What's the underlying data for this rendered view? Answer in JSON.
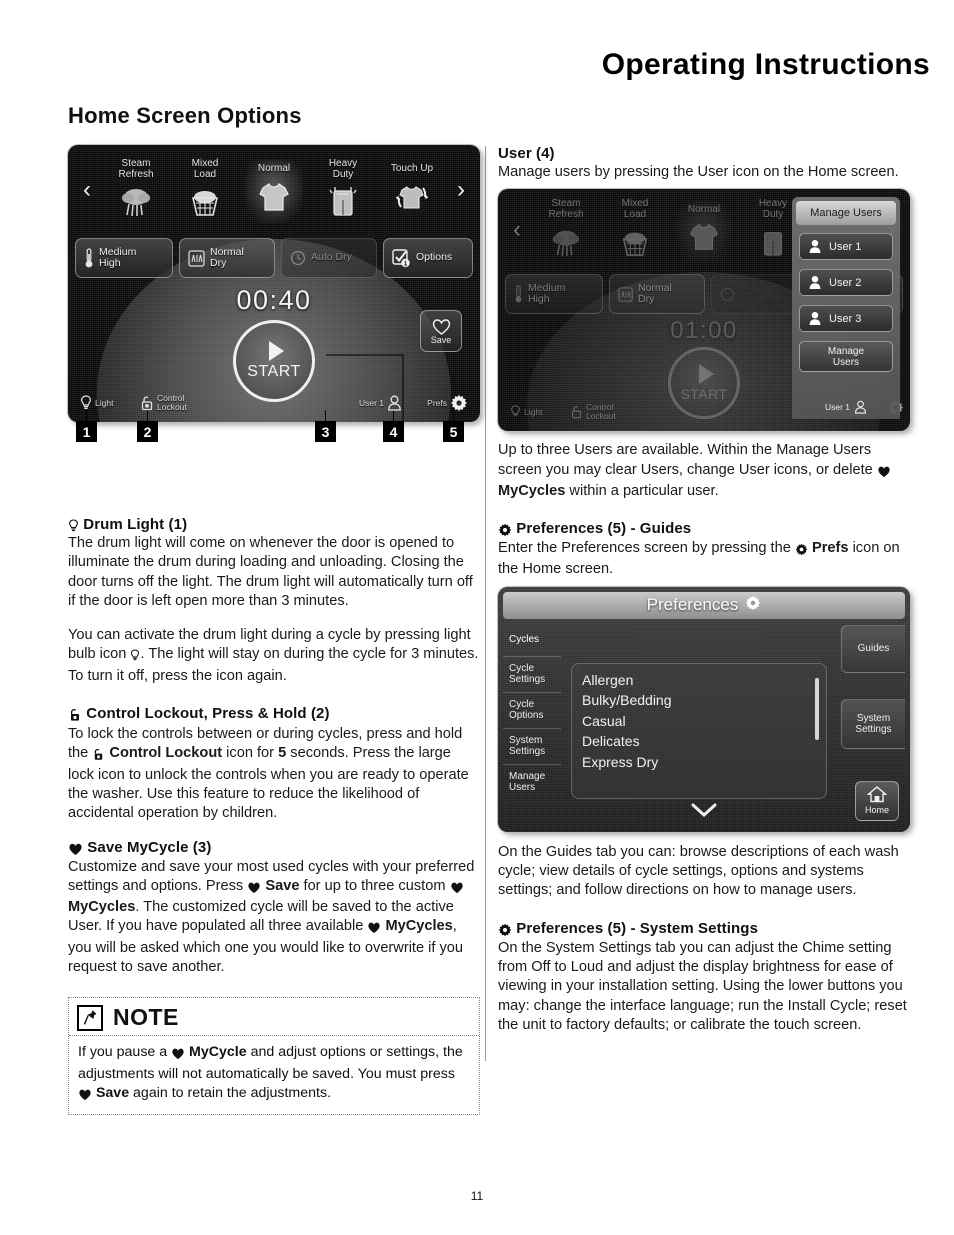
{
  "header": {
    "running_head": "Operating Instructions",
    "section_title": "Home Screen Options",
    "page_number": "11"
  },
  "control_panel": {
    "caption_numbers": [
      "1",
      "2",
      "3",
      "4",
      "5"
    ],
    "prev_arrow": "‹",
    "next_arrow": "›",
    "cycles": [
      {
        "label": "Steam\nRefresh",
        "icon": "steam-refresh-icon",
        "selected": false
      },
      {
        "label": "Mixed\nLoad",
        "icon": "basket-icon",
        "selected": false
      },
      {
        "label": "Normal",
        "icon": "tshirt-icon",
        "selected": true
      },
      {
        "label": "Heavy\nDuty",
        "icon": "overalls-icon",
        "selected": false
      },
      {
        "label": "Touch Up",
        "icon": "touch-up-icon",
        "selected": false
      }
    ],
    "setting_buttons": [
      {
        "label": "Medium\nHigh",
        "icon": "thermometer-icon",
        "enabled": true
      },
      {
        "label": "Normal\nDry",
        "icon": "dryness-icon",
        "enabled": true
      },
      {
        "label": "Auto Dry",
        "icon": "clock-icon",
        "enabled": false
      },
      {
        "label": "Options",
        "icon": "checkbox-icon",
        "badge": "1",
        "enabled": true
      }
    ],
    "timer": "00:40",
    "start_label": "START",
    "save_label": "Save",
    "status_left": [
      {
        "label": "Light",
        "icon": "light-bulb-icon"
      },
      {
        "label": "Control\nLockout",
        "icon": "padlock-icon"
      }
    ],
    "status_right": [
      {
        "label": "User 1",
        "icon": "user-icon"
      },
      {
        "label": "Prefs",
        "icon": "gear-icon"
      }
    ]
  },
  "left_column": {
    "drum_light": {
      "heading_icon": "light-bulb-icon",
      "heading": "Drum Light (1)",
      "paragraph_1": "The drum light will come on whenever the door is opened to illuminate the drum during loading and unloading. Closing the door turns off the light. The drum light will automatically turn off if the door is left open more than 3 minutes.",
      "paragraph_2_a": "You can activate the drum light during a cycle by pressing light bulb icon",
      "paragraph_2_b": ". The light will stay on during the cycle for 3 minutes. To turn it off, press the icon again."
    },
    "control_lockout": {
      "heading_icon": "padlock-icon",
      "heading": "Control Lockout, Press & Hold (2)",
      "text_a": "To lock the controls between or during cycles, press and hold the",
      "text_bold": "Control Lockout",
      "text_b": "icon for",
      "text_bold2": "5",
      "text_c": "seconds. Press the large lock icon to unlock the controls when you are ready to operate the washer. Use this feature to reduce the likelihood of accidental operation by children."
    },
    "save_mycycle": {
      "heading_icon": "heart-icon",
      "heading": "Save MyCycle (3)",
      "text_a": "Customize and save your most used cycles with your preferred settings and options. Press",
      "bold_save": "Save",
      "text_b": "for up to three custom",
      "bold_mycycles": "MyCycles",
      "text_c": ". The customized cycle will be saved to the active User. If you have populated all three available",
      "bold_mycycles2": "MyCycles",
      "text_d": ", you will be asked which one you would like to overwrite if you request to save another."
    },
    "note": {
      "icon": "push-pin-icon",
      "title": "NOTE",
      "text_a": "If you pause a",
      "bold_mycycle": "MyCycle",
      "text_b": "and adjust options or settings, the adjustments will not automatically be saved. You must press",
      "bold_save": "Save",
      "text_c": "again to retain the adjustments."
    }
  },
  "right_column": {
    "user": {
      "heading": "User (4)",
      "intro": "Manage users by pressing the User icon on the Home screen.",
      "after_image": "Up to three Users are available. Within the Manage Users screen you may clear Users, change User icons, or delete",
      "after_image_bold": "MyCycles",
      "after_image_end": "within a particular user."
    },
    "manage_users_screen": {
      "title": "Manage Users",
      "buttons": [
        "User 1",
        "User 2",
        "User 3"
      ],
      "manage_button": "Manage\nUsers",
      "status_user": "User 1",
      "prev_arrow": "‹",
      "next_arrow": "›"
    },
    "prefs_guides": {
      "heading_icon": "gear-icon",
      "heading": "Preferences (5) - Guides",
      "intro_a": "Enter the Preferences screen by pressing the",
      "intro_bold": "Prefs",
      "intro_b": "icon on the Home screen.",
      "after": "On the Guides tab you can: browse descriptions of each wash cycle; view details of cycle settings, options and systems settings; and follow directions on how to manage users."
    },
    "preferences_screen": {
      "title": "Preferences",
      "title_icon": "gear-icon",
      "tabs": [
        "Cycles",
        "Cycle\nSettings",
        "Cycle\nOptions",
        "System\nSettings",
        "Manage\nUsers"
      ],
      "list_items": [
        "Allergen",
        "Bulky/Bedding",
        "Casual",
        "Delicates",
        "Express Dry"
      ],
      "right_buttons": [
        "Guides",
        "System\nSettings"
      ],
      "home_button": "Home",
      "home_icon": "home-icon",
      "scroll_down_icon": "chevron-down-icon"
    },
    "prefs_system": {
      "heading_icon": "gear-icon",
      "heading": "Preferences (5) - System Settings",
      "text": "On the System Settings tab you can adjust the Chime setting from Off to Loud and adjust the display brightness for ease of viewing in your installation setting. Using the lower buttons you may: change the interface language; run the Install Cycle; reset the unit to factory defaults; or calibrate the touch screen."
    }
  },
  "glyphs": {
    "heart": "♥",
    "gear": "⚙",
    "bulb": "⚯",
    "lock": "▣",
    "pin": "✐"
  },
  "colors": {
    "ink": "#111111",
    "panel_bg": "#0a0a0a",
    "panel_text": "#eaeaea",
    "divider": "#9a9a9a"
  }
}
